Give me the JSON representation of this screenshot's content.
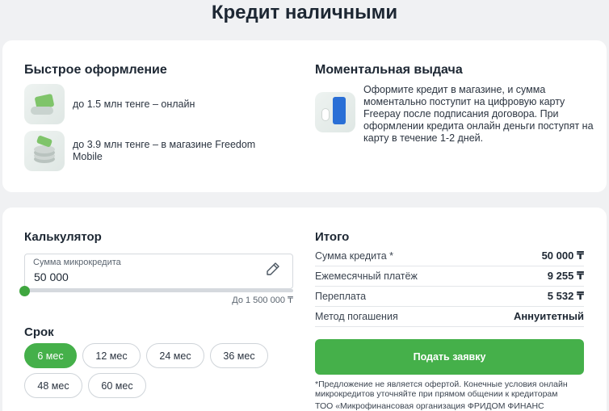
{
  "page": {
    "title": "Кредит наличными"
  },
  "fast": {
    "title": "Быстрое оформление",
    "items": [
      {
        "icon": "money-hand-icon",
        "text": "до 1.5 млн тенге – онлайн"
      },
      {
        "icon": "coins-stack-icon",
        "text": "до 3.9 млн тенге – в магазине Freedom Mobile"
      }
    ]
  },
  "instant": {
    "title": "Моментальная выдача",
    "icon": "card-phone-icon",
    "text": "Оформите кредит в магазине, и сумма моментально поступит на цифровую карту Freepay после подписания договора. При оформлении кредита онлайн деньги поступят на карту в течение 1-2 дней."
  },
  "calculator": {
    "title": "Калькулятор",
    "amount_label": "Сумма микрокредита",
    "amount_value": "50 000",
    "max_label": "До 1 500 000 ₸",
    "slider_fraction": 0.0,
    "term_title": "Срок",
    "terms": [
      "6 мес",
      "12 мес",
      "24 мес",
      "36 мес",
      "48 мес",
      "60 мес"
    ],
    "selected_term": "6 мес"
  },
  "summary": {
    "title": "Итого",
    "rows": [
      {
        "label": "Сумма кредита *",
        "value": "50 000 ₸"
      },
      {
        "label": "Ежемесячный платёж",
        "value": "9 255 ₸"
      },
      {
        "label": "Переплата",
        "value": "5 532 ₸"
      },
      {
        "label": "Метод погашения",
        "value": "Аннуитетный"
      }
    ],
    "submit_label": "Подать заявку",
    "disclaimer": "*Предложение не является офертой. Конечные условия онлайн микрокредитов уточняйте при прямом общении к кредиторам",
    "org": "ТОО «Микрофинансовая организация ФРИДОМ ФИНАНС"
  },
  "colors": {
    "accent": "#45b04a",
    "background": "#f0f1f3",
    "text": "#1d2733"
  }
}
